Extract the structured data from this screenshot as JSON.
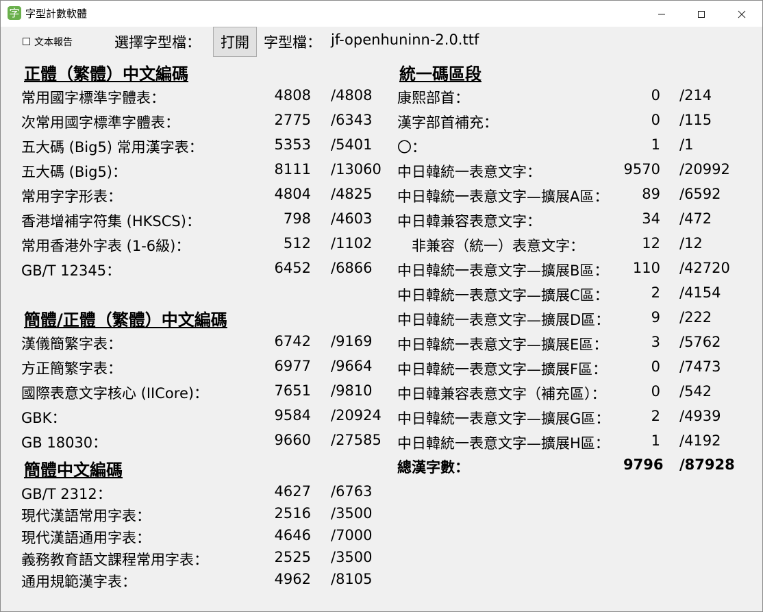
{
  "window": {
    "title": "字型計數軟體",
    "app_icon_glyph": "字",
    "minimize_glyph": "—",
    "maximize_glyph": "☐",
    "close_glyph": "✕"
  },
  "toolbar": {
    "report_checkbox_label": "文本報告",
    "report_checked": false,
    "choose_font_label": "選擇字型檔：",
    "open_button_label": "打開",
    "font_file_label": "字型檔：",
    "font_file_name": "jf-openhuninn-2.0.ttf"
  },
  "sections": {
    "traditional": {
      "title": "正體（繁體）中文編碼",
      "rows": [
        {
          "label": "常用國字標準字體表：",
          "count": "4808",
          "total": "/4808"
        },
        {
          "label": "次常用國字標準字體表：",
          "count": "2775",
          "total": "/6343"
        },
        {
          "label": "五大碼 (Big5) 常用漢字表：",
          "count": "5353",
          "total": "/5401"
        },
        {
          "label": "五大碼 (Big5)：",
          "count": "8111",
          "total": "/13060"
        },
        {
          "label": "常用字字形表：",
          "count": "4804",
          "total": "/4825"
        },
        {
          "label": "香港增補字符集 (HKSCS)：",
          "count": "798",
          "total": "/4603"
        },
        {
          "label": "常用香港外字表 (1-6級)：",
          "count": "512",
          "total": "/1102"
        },
        {
          "label": "GB/T 12345：",
          "count": "6452",
          "total": "/6866"
        }
      ]
    },
    "simp_trad": {
      "title": "簡體/正體（繁體）中文編碼",
      "rows": [
        {
          "label": "漢儀簡繁字表：",
          "count": "6742",
          "total": "/9169"
        },
        {
          "label": "方正簡繁字表：",
          "count": "6977",
          "total": "/9664"
        },
        {
          "label": "國際表意文字核心 (IICore)：",
          "count": "7651",
          "total": "/9810"
        },
        {
          "label": "GBK：",
          "count": "9584",
          "total": "/20924"
        },
        {
          "label": "GB 18030：",
          "count": "9660",
          "total": "/27585"
        }
      ]
    },
    "simplified": {
      "title": "簡體中文編碼",
      "rows": [
        {
          "label": "GB/T 2312：",
          "count": "4627",
          "total": "/6763"
        },
        {
          "label": "現代漢語常用字表：",
          "count": "2516",
          "total": "/3500"
        },
        {
          "label": "現代漢語通用字表：",
          "count": "4646",
          "total": "/7000"
        },
        {
          "label": "義務教育語文課程常用字表：",
          "count": "2525",
          "total": "/3500"
        },
        {
          "label": "通用規範漢字表：",
          "count": "4962",
          "total": "/8105"
        }
      ]
    },
    "unicode": {
      "title": "統一碼區段",
      "rows": [
        {
          "label": "康熙部首：",
          "count": "0",
          "total": "/214"
        },
        {
          "label": "漢字部首補充：",
          "count": "0",
          "total": "/115"
        },
        {
          "label": "〇：",
          "count": "1",
          "total": "/1"
        },
        {
          "label": "中日韓統一表意文字：",
          "count": "9570",
          "total": "/20992"
        },
        {
          "label": "中日韓統一表意文字—擴展A區：",
          "count": "89",
          "total": "/6592"
        },
        {
          "label": "中日韓兼容表意文字：",
          "count": "34",
          "total": "/472"
        },
        {
          "label": "　非兼容（統一）表意文字：",
          "count": "12",
          "total": "/12"
        },
        {
          "label": "中日韓統一表意文字—擴展B區：",
          "count": "110",
          "total": "/42720"
        },
        {
          "label": "中日韓統一表意文字—擴展C區：",
          "count": "2",
          "total": "/4154"
        },
        {
          "label": "中日韓統一表意文字—擴展D區：",
          "count": "9",
          "total": "/222"
        },
        {
          "label": "中日韓統一表意文字—擴展E區：",
          "count": "3",
          "total": "/5762"
        },
        {
          "label": "中日韓統一表意文字—擴展F區：",
          "count": "0",
          "total": "/7473"
        },
        {
          "label": "中日韓兼容表意文字（補充區）：",
          "count": "0",
          "total": "/542"
        },
        {
          "label": "中日韓統一表意文字—擴展G區：",
          "count": "2",
          "total": "/4939"
        },
        {
          "label": "中日韓統一表意文字—擴展H區：",
          "count": "1",
          "total": "/4192"
        }
      ],
      "summary": {
        "label": "總漢字數：",
        "count": "9796",
        "total": "/87928"
      }
    }
  }
}
